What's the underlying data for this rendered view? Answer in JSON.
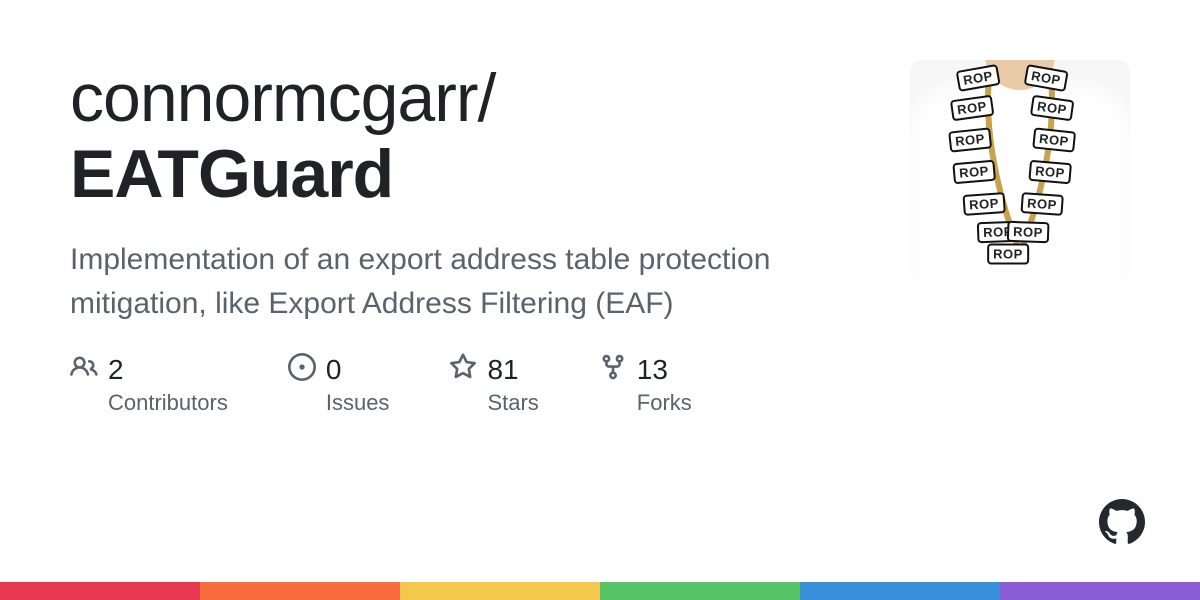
{
  "repo": {
    "owner": "connormcgarr",
    "slash": "/",
    "name": "EATGuard",
    "description": "Implementation of an export address table protection mitigation, like Export Address Filtering (EAF)"
  },
  "stats": {
    "contributors": {
      "value": "2",
      "label": "Contributors"
    },
    "issues": {
      "value": "0",
      "label": "Issues"
    },
    "stars": {
      "value": "81",
      "label": "Stars"
    },
    "forks": {
      "value": "13",
      "label": "Forks"
    }
  },
  "avatar": {
    "tag_text": "ROP"
  },
  "colors": {
    "rainbow": [
      "#e8384f",
      "#fa6c3d",
      "#f2c94c",
      "#56c568",
      "#3a8fdd",
      "#8a5cd6"
    ]
  }
}
